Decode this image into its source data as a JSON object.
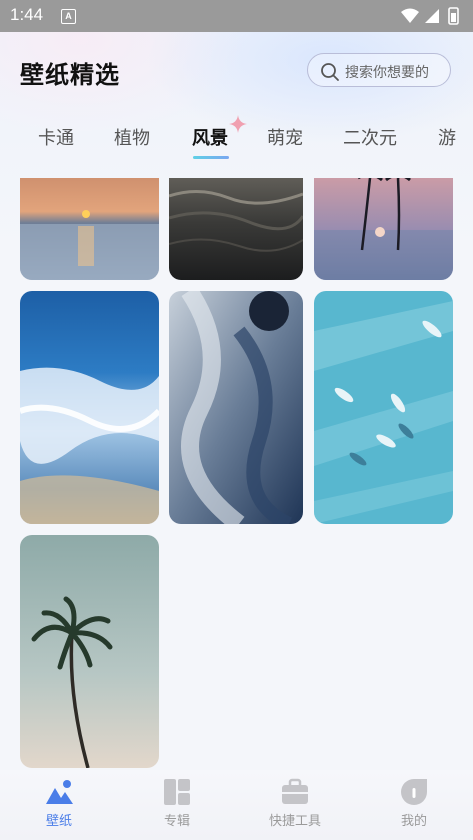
{
  "status_bar": {
    "time": "1:44",
    "notification_icon": "A"
  },
  "header": {
    "title": "壁纸精选",
    "search_placeholder": "搜索你想要的"
  },
  "tabs": [
    {
      "label": "卡通",
      "active": false
    },
    {
      "label": "植物",
      "active": false
    },
    {
      "label": "风景",
      "active": true
    },
    {
      "label": "萌宠",
      "active": false
    },
    {
      "label": "二次元",
      "active": false
    },
    {
      "label": "游",
      "active": false
    }
  ],
  "wallpapers": [
    {
      "subject": "sunset over sea"
    },
    {
      "subject": "dark ocean waves"
    },
    {
      "subject": "palm trees at dusk"
    },
    {
      "subject": "beach surf"
    },
    {
      "subject": "stormy wave"
    },
    {
      "subject": "dolphins in turquoise water"
    },
    {
      "subject": "tall palm tree"
    }
  ],
  "bottom_nav": [
    {
      "label": "壁纸",
      "icon": "wallpaper-icon",
      "active": true
    },
    {
      "label": "专辑",
      "icon": "album-icon",
      "active": false
    },
    {
      "label": "快捷工具",
      "icon": "toolbox-icon",
      "active": false
    },
    {
      "label": "我的",
      "icon": "profile-icon",
      "active": false
    }
  ],
  "colors": {
    "accent": "#4a7de8",
    "tab_underline": "#5fd0e6"
  }
}
